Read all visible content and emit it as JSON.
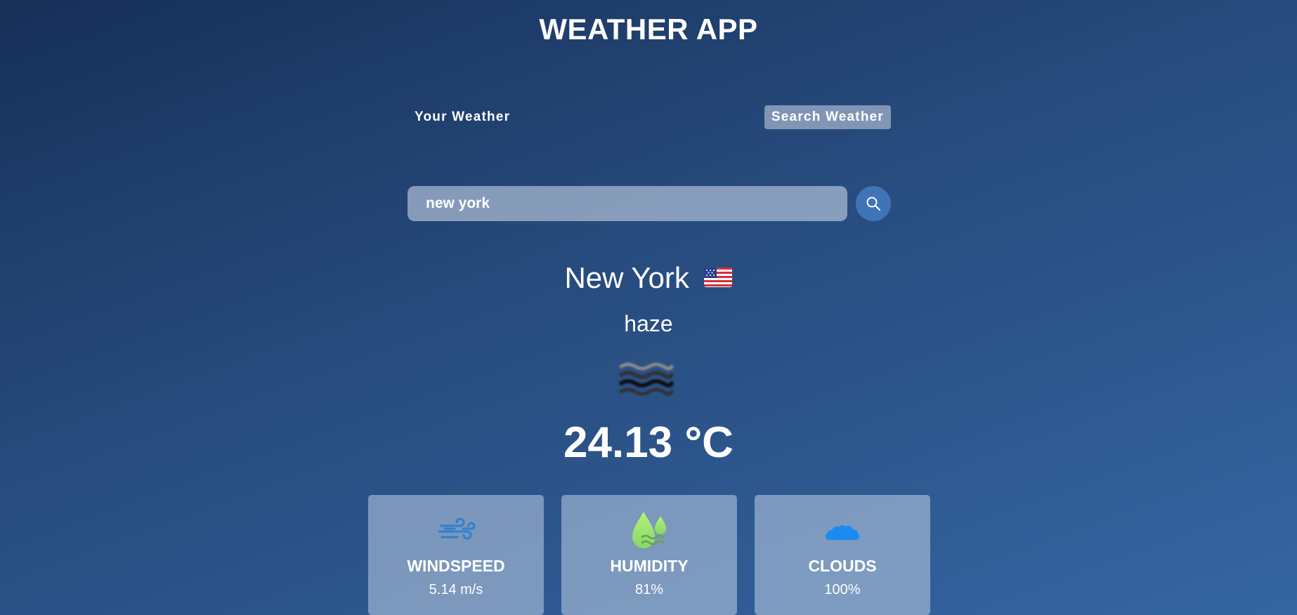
{
  "app": {
    "title": "WEATHER APP"
  },
  "tabs": [
    {
      "label": "Your Weather",
      "active": false
    },
    {
      "label": "Search Weather",
      "active": true
    }
  ],
  "search": {
    "value": "new york",
    "placeholder": "",
    "icon": "search-icon"
  },
  "location": {
    "city": "New York",
    "flag": "us-flag-icon"
  },
  "weather": {
    "description": "haze",
    "icon": "haze-icon",
    "temperature": "24.13 °C"
  },
  "stats": [
    {
      "label": "WINDSPEED",
      "value": "5.14 m/s",
      "icon": "wind-icon"
    },
    {
      "label": "HUMIDITY",
      "value": "81%",
      "icon": "humidity-icon"
    },
    {
      "label": "CLOUDS",
      "value": "100%",
      "icon": "clouds-icon"
    }
  ],
  "colors": {
    "background_top": "#163058",
    "background_bottom": "#3566a3",
    "search_button": "#3f74b8",
    "wind_icon": "#2f7fd0",
    "humidity_icon": "#a6e07a",
    "clouds_icon": "#1c8bf0"
  }
}
